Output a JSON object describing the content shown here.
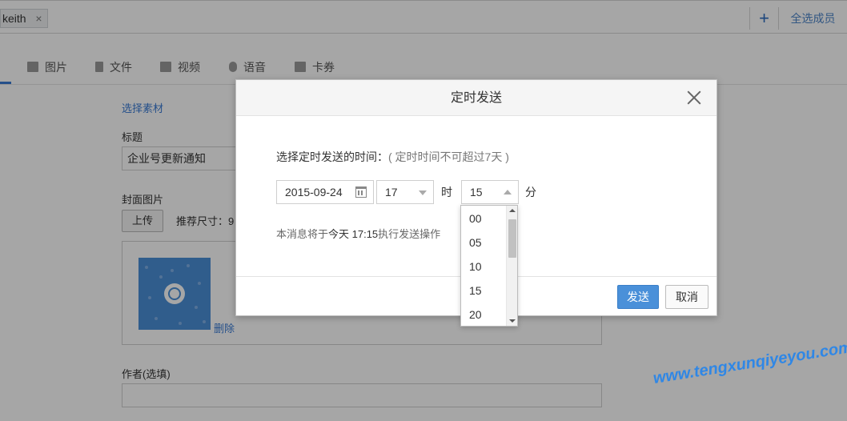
{
  "recipients": {
    "tag": "keith",
    "tag_remove": "×",
    "add_symbol": "+",
    "select_all": "全选成员"
  },
  "tabs": [
    {
      "label": "图片",
      "icon": "image-icon"
    },
    {
      "label": "文件",
      "icon": "file-icon"
    },
    {
      "label": "视频",
      "icon": "video-icon"
    },
    {
      "label": "语音",
      "icon": "microphone-icon"
    },
    {
      "label": "卡券",
      "icon": "ticket-icon"
    }
  ],
  "form": {
    "select_material": "选择素材",
    "title_label": "标题",
    "title_value": "企业号更新通知",
    "cover_label": "封面图片",
    "upload_button": "上传",
    "recommended_size": "推荐尺寸：9",
    "delete_link": "删除",
    "author_label": "作者(选填)"
  },
  "modal": {
    "title": "定时发送",
    "prompt": "选择定时发送的时间：",
    "prompt_hint": "( 定时时间不可超过7天 )",
    "date_value": "2015-09-24",
    "hour_value": "17",
    "hour_unit": "时",
    "minute_value": "15",
    "minute_unit": "分",
    "notice_prefix": "本消息将于",
    "notice_time": "今天 17:15",
    "notice_suffix": "执行发送操作",
    "send_button": "发送",
    "cancel_button": "取消"
  },
  "minute_options": [
    "00",
    "05",
    "10",
    "15",
    "20"
  ],
  "watermark": "www.tengxunqiyeyou.com",
  "colors": {
    "accent": "#3a7bd5",
    "primary_button": "#4a90d9",
    "watermark": "#2f87e6"
  }
}
